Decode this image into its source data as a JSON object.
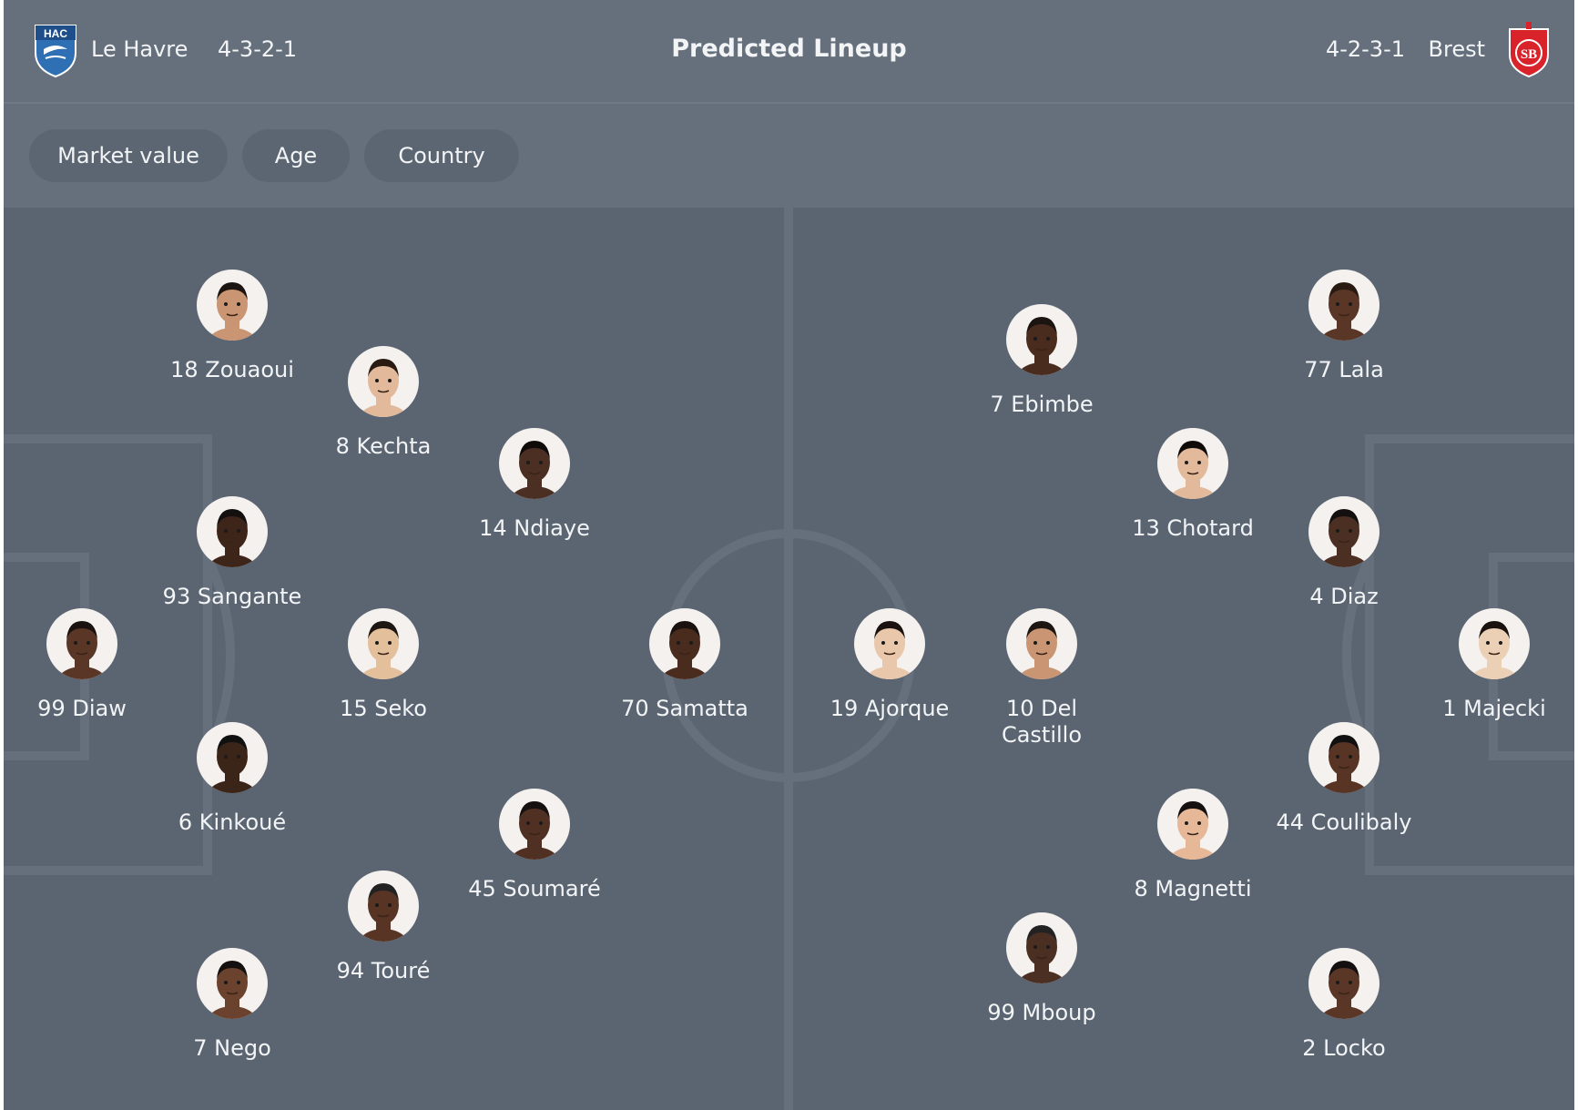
{
  "header": {
    "home_team": "Le Havre",
    "home_formation": "4-3-2-1",
    "home_logo_text": "HAC",
    "title": "Predicted Lineup",
    "away_formation": "4-2-3-1",
    "away_team": "Brest",
    "away_logo_text": "SB"
  },
  "filters": [
    "Market value",
    "Age",
    "Country"
  ],
  "colors": {
    "card_bg": "#5b6572",
    "header_bg": "#66707c",
    "pitch_lines": "#66707c",
    "home_logo": "#2f6fb3",
    "away_logo": "#d8232a"
  },
  "home_players": [
    {
      "number": "18",
      "name": "Zouaoui",
      "label": "18 Zouaoui"
    },
    {
      "number": "8",
      "name": "Kechta",
      "label": "8 Kechta"
    },
    {
      "number": "14",
      "name": "Ndiaye",
      "label": "14 Ndiaye"
    },
    {
      "number": "93",
      "name": "Sangante",
      "label": "93 Sangante"
    },
    {
      "number": "99",
      "name": "Diaw",
      "label": "99 Diaw"
    },
    {
      "number": "15",
      "name": "Seko",
      "label": "15 Seko"
    },
    {
      "number": "70",
      "name": "Samatta",
      "label": "70 Samatta"
    },
    {
      "number": "6",
      "name": "Kinkoué",
      "label": "6 Kinkoué"
    },
    {
      "number": "45",
      "name": "Soumaré",
      "label": "45 Soumaré"
    },
    {
      "number": "94",
      "name": "Touré",
      "label": "94 Touré"
    },
    {
      "number": "7",
      "name": "Nego",
      "label": "7 Nego"
    }
  ],
  "away_players": [
    {
      "number": "7",
      "name": "Ebimbe",
      "label": "7 Ebimbe"
    },
    {
      "number": "77",
      "name": "Lala",
      "label": "77 Lala"
    },
    {
      "number": "13",
      "name": "Chotard",
      "label": "13 Chotard"
    },
    {
      "number": "4",
      "name": "Diaz",
      "label": "4 Diaz"
    },
    {
      "number": "19",
      "name": "Ajorque",
      "label": "19 Ajorque"
    },
    {
      "number": "10",
      "name": "Del Castillo",
      "label": "10 Del Castillo"
    },
    {
      "number": "1",
      "name": "Majecki",
      "label": "1 Majecki"
    },
    {
      "number": "44",
      "name": "Coulibaly",
      "label": "44 Coulibaly"
    },
    {
      "number": "8",
      "name": "Magnetti",
      "label": "8 Magnetti"
    },
    {
      "number": "99",
      "name": "Mboup",
      "label": "99 Mboup"
    },
    {
      "number": "2",
      "name": "Locko",
      "label": "2 Locko"
    }
  ]
}
